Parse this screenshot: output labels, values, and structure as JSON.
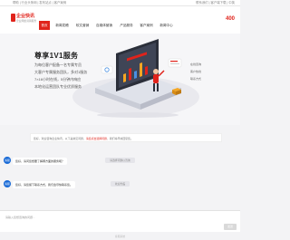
{
  "top_strip": {
    "links": "帮助 | 行业头条网 | 发布站点 | 客户案例",
    "right_links": "联系我们 | 客户端下载 | 中英"
  },
  "header": {
    "logo_text": "企业快讯",
    "logo_sub": "企业网络营销服务",
    "phone": "400"
  },
  "nav": {
    "items": [
      {
        "label": "首页",
        "active": true
      },
      {
        "label": "新闻发稿",
        "active": false
      },
      {
        "label": "软文营销",
        "active": false
      },
      {
        "label": "自媒体营销",
        "active": false
      },
      {
        "label": "产品服务",
        "active": false
      },
      {
        "label": "客户案例",
        "active": false
      },
      {
        "label": "新闻中心",
        "active": false
      }
    ]
  },
  "banner": {
    "title": "尊享1V1服务",
    "lines": [
      "为每位客户配备一名专属专员",
      "大客户专属服务团队，多对1服务",
      "7×16小时在线，5分钟内响应",
      "本地化运营团队专业优质服务"
    ],
    "side_rows": [
      "在线咨询",
      "客户热线",
      "联系方式"
    ]
  },
  "chat": {
    "notice_prefix": "您好，欢迎咨询企业快讯，以下是常见问题，",
    "notice_highlight": "请您点击选择问题",
    "notice_suffix": "，我们将尽快回复您。",
    "timestamp1": "请选择问题以咨询",
    "avatar_label": "客服",
    "bubble1": "您好，请问您想要了解哪方面的服务呢？",
    "timestamp2": "欢迎光临",
    "bubble2": "您好，请您留下联系方式，我们会尽快联系您。",
    "input_placeholder": "请输入您想咨询的问题...",
    "send_label": "发送"
  },
  "footer": {
    "text": "客服系统"
  },
  "colors": {
    "brand_red": "#e0231b",
    "avatar_blue": "#1769d6"
  }
}
